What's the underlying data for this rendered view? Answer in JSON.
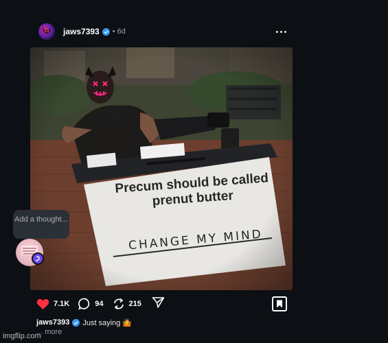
{
  "post": {
    "username": "jaws7393",
    "separator": "•",
    "time_ago": "6d",
    "more_icon": "more-horizontal-icon"
  },
  "meme": {
    "caption": "Precum should be called prenut butter",
    "sign_text": "CHANGE MY MIND"
  },
  "thought": {
    "prompt": "Add a thought..."
  },
  "actions": {
    "likes": "7.1K",
    "comments": "94",
    "reposts": "215"
  },
  "caption": {
    "username": "jaws7393",
    "text": "Just saying 🤷",
    "more": "... more"
  },
  "watermark": "imgflip.com",
  "colors": {
    "background": "#0c0f14",
    "like": "#ff3040",
    "verified": "#3897f0",
    "thought_badge": "#6a49f0"
  }
}
